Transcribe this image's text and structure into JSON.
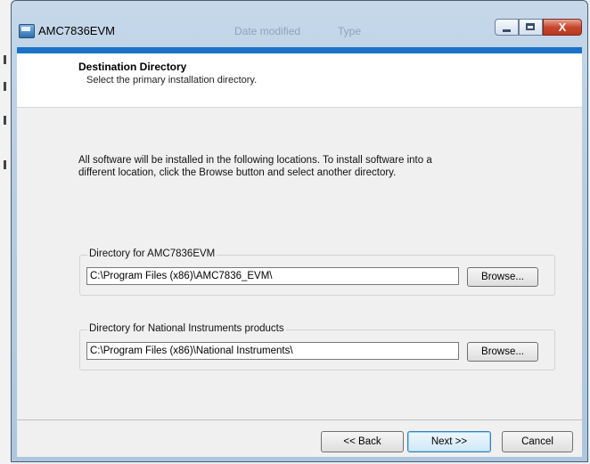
{
  "window": {
    "title": "AMC7836EVM",
    "ghost_texts": [
      "Date modified",
      "Type"
    ],
    "close_glyph": "X"
  },
  "header": {
    "title": "Destination Directory",
    "subtitle": "Select the primary installation directory."
  },
  "body": {
    "description": "All software will be installed in the following locations. To install software into a different location, click the Browse button and select another directory."
  },
  "directories": [
    {
      "label": "Directory for AMC7836EVM",
      "path": "C:\\Program Files (x86)\\AMC7836_EVM\\",
      "browse_label": "Browse..."
    },
    {
      "label": "Directory for National Instruments products",
      "path": "C:\\Program Files (x86)\\National Instruments\\",
      "browse_label": "Browse..."
    }
  ],
  "footer": {
    "back_label": "<< Back",
    "next_label": "Next >>",
    "cancel_label": "Cancel"
  },
  "colors": {
    "accent_bar": "#1a73c8",
    "close_button": "#c9472f"
  }
}
